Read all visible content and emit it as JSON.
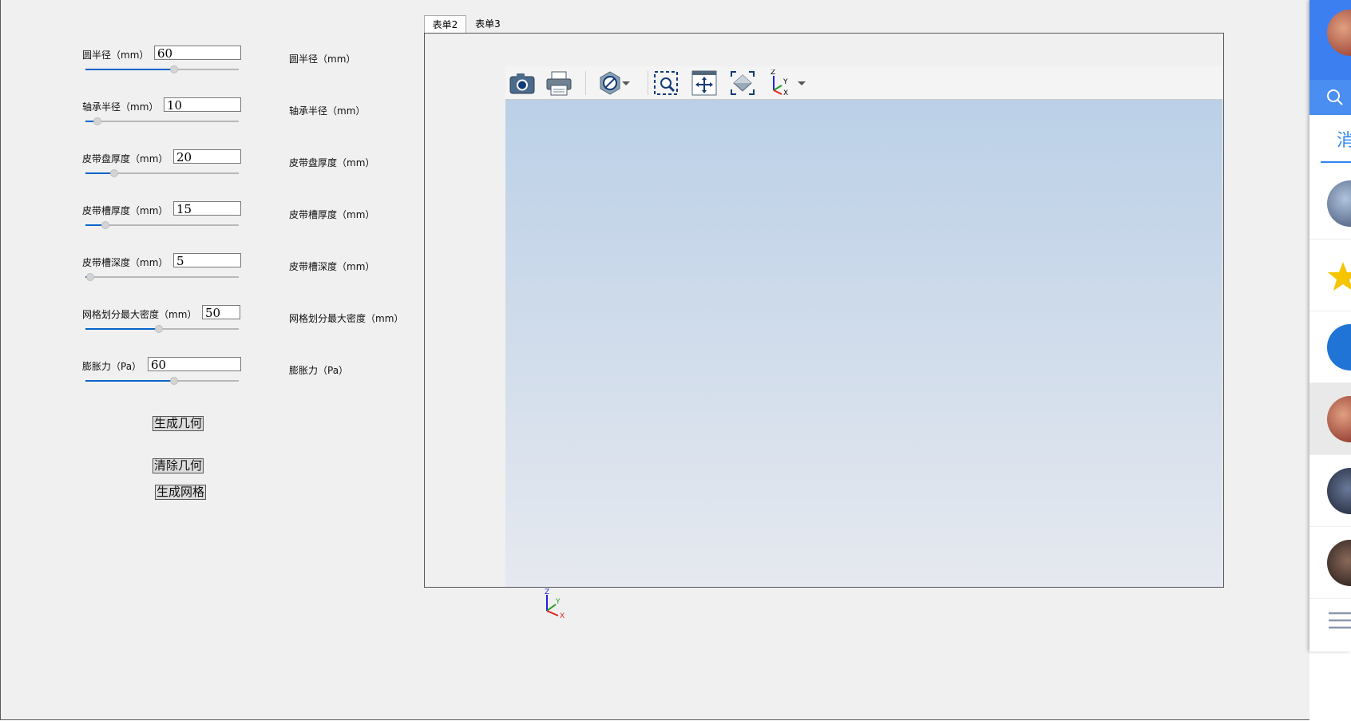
{
  "params": [
    {
      "label": "圆半径（mm）",
      "value": "60",
      "fraction": 0.58,
      "right_label": "圆半径（mm）"
    },
    {
      "label": "轴承半径（mm）",
      "value": "10",
      "fraction": 0.08,
      "right_label": "轴承半径（mm）"
    },
    {
      "label": "皮带盘厚度（mm）",
      "value": "20",
      "fraction": 0.19,
      "right_label": "皮带盘厚度（mm）"
    },
    {
      "label": "皮带槽厚度（mm）",
      "value": "15",
      "fraction": 0.13,
      "right_label": "皮带槽厚度（mm）"
    },
    {
      "label": "皮带槽深度（mm）",
      "value": "5",
      "fraction": 0.03,
      "right_label": "皮带槽深度（mm）"
    },
    {
      "label": "网格划分最大密度（mm）",
      "value": "50",
      "fraction": 0.48,
      "right_label": "网格划分最大密度（mm）"
    },
    {
      "label": "膨胀力（Pa）",
      "value": "60",
      "fraction": 0.58,
      "right_label": "膨胀力（Pa）"
    }
  ],
  "buttons": {
    "generate_geometry": "生成几何",
    "clear_geometry": "清除几何",
    "generate_mesh": "生成网格"
  },
  "tabs": [
    "表单2",
    "表单3"
  ],
  "active_tab": "表单2",
  "viewer": {
    "toolbar_icons": [
      "camera-icon",
      "print-icon",
      "visibility-icon",
      "zoom-window-icon",
      "pan-icon",
      "fit-all-icon",
      "view-orientation-icon"
    ],
    "axis_labels": {
      "z": "Z",
      "y": "Y",
      "x": "X"
    },
    "background_top": "#bbd0e7",
    "background_bottom": "#e6e9ef"
  },
  "side_panel": {
    "tab_label": "消",
    "accent": "#3c7ff0"
  },
  "colors": {
    "slider_fill": "#0a64c8",
    "axis_x": "#e02020",
    "axis_y": "#20a020",
    "axis_z": "#2020e0"
  }
}
